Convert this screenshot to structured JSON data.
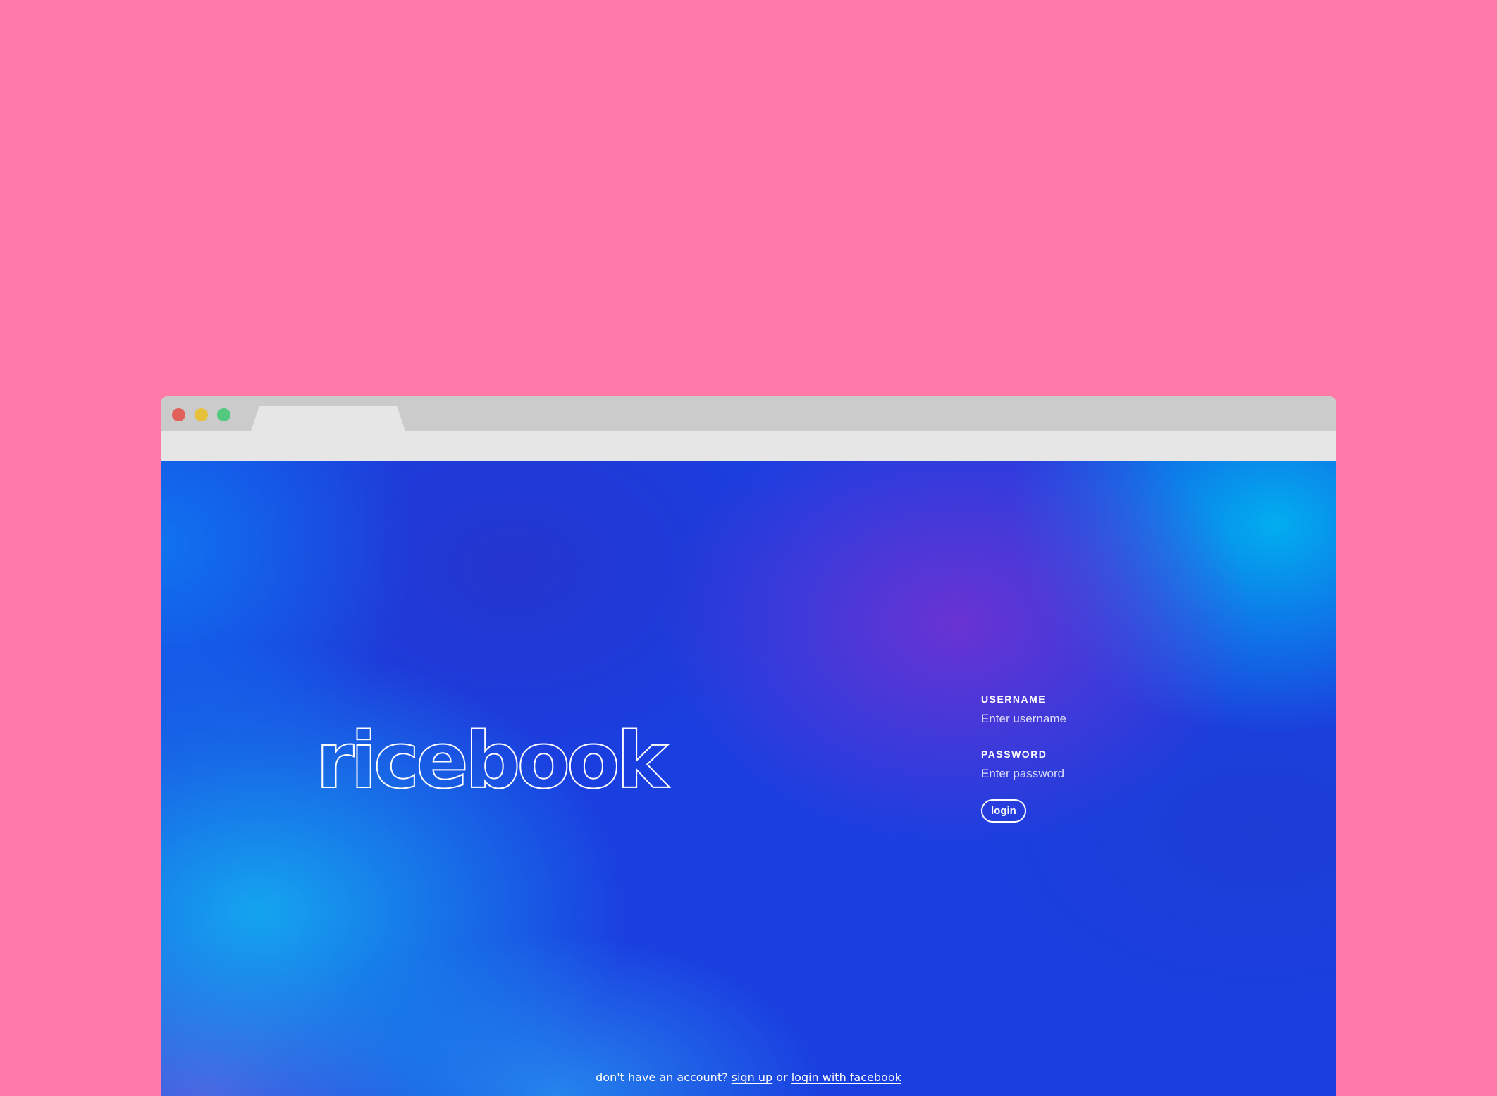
{
  "background_color": "#ff7aa8",
  "browser": {
    "traffic_lights": {
      "close_color": "#e0605a",
      "minimize_color": "#e6c23c",
      "maximize_color": "#52c97f"
    },
    "tab_title": ""
  },
  "page": {
    "logo_text": "ricebook",
    "username": {
      "label": "USERNAME",
      "value": "",
      "placeholder": "Enter username"
    },
    "password": {
      "label": "PASSWORD",
      "value": "",
      "placeholder": "Enter password"
    },
    "login_button_label": "login",
    "footer": {
      "prompt": "don't have an account?",
      "signup_link": "sign up",
      "or_text": "or",
      "facebook_link": "login with facebook"
    }
  }
}
